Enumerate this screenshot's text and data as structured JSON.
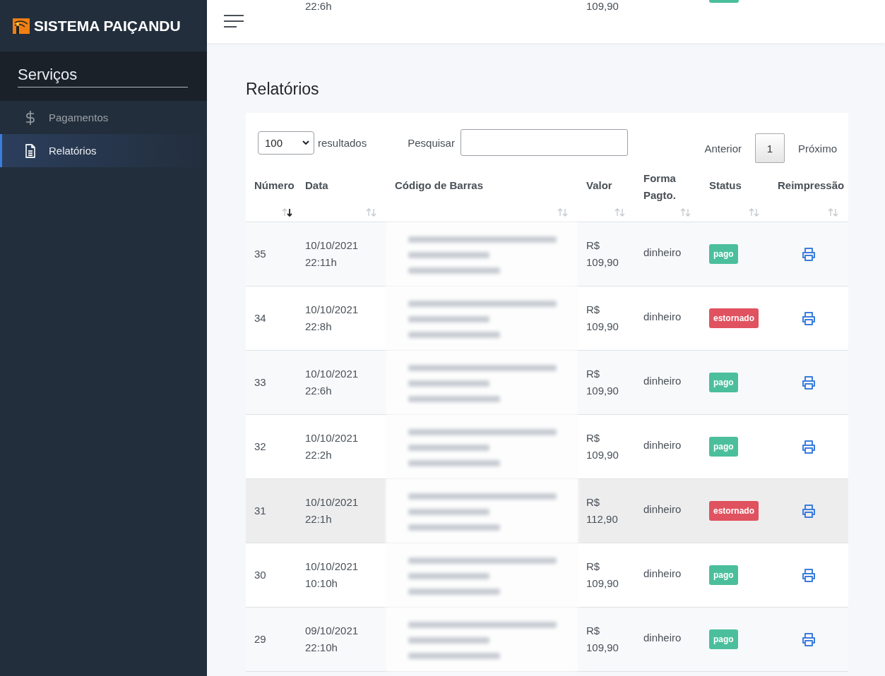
{
  "sidebar": {
    "brand": "SISTEMA PAIÇANDU",
    "section": "Serviços",
    "items": [
      {
        "label": "Pagamentos",
        "selected": false
      },
      {
        "label": "Relatórios",
        "selected": true
      }
    ]
  },
  "scrolled_row": {
    "date": "22:6h",
    "value": "109,90",
    "status": {
      "color": "#4bbf9b"
    }
  },
  "page_title": "Relatórios",
  "controls": {
    "page_size": "100",
    "page_size_label": "resultados",
    "search_label": "Pesquisar",
    "previous": "Anterior",
    "page": "1",
    "next": "Próximo"
  },
  "table": {
    "columns": [
      {
        "label": "Número",
        "sorted": true
      },
      {
        "label": "Data",
        "sorted": false
      },
      {
        "label": "Código de Barras",
        "sorted": false
      },
      {
        "label": "Valor",
        "sorted": false
      },
      {
        "label": "Forma Pagto.",
        "sorted": false
      },
      {
        "label": "Status",
        "sorted": false
      },
      {
        "label": "Reimpressão",
        "sorted": false
      }
    ],
    "rows": [
      {
        "number": "35",
        "date": "10/10/2021",
        "time": "22:11h",
        "currency": "R$",
        "value": "109,90",
        "method": "dinheiro",
        "status": {
          "label": "pago",
          "color": "#4bbf9b"
        },
        "hovered": false
      },
      {
        "number": "34",
        "date": "10/10/2021",
        "time": "22:8h",
        "currency": "R$",
        "value": "109,90",
        "method": "dinheiro",
        "status": {
          "label": "estornado",
          "color": "#e0525f"
        },
        "hovered": false
      },
      {
        "number": "33",
        "date": "10/10/2021",
        "time": "22:6h",
        "currency": "R$",
        "value": "109,90",
        "method": "dinheiro",
        "status": {
          "label": "pago",
          "color": "#4bbf9b"
        },
        "hovered": false
      },
      {
        "number": "32",
        "date": "10/10/2021",
        "time": "22:2h",
        "currency": "R$",
        "value": "109,90",
        "method": "dinheiro",
        "status": {
          "label": "pago",
          "color": "#4bbf9b"
        },
        "hovered": false
      },
      {
        "number": "31",
        "date": "10/10/2021",
        "time": "22:1h",
        "currency": "R$",
        "value": "112,90",
        "method": "dinheiro",
        "status": {
          "label": "estornado",
          "color": "#e0525f"
        },
        "hovered": true
      },
      {
        "number": "30",
        "date": "10/10/2021",
        "time": "10:10h",
        "currency": "R$",
        "value": "109,90",
        "method": "dinheiro",
        "status": {
          "label": "pago",
          "color": "#4bbf9b"
        },
        "hovered": false
      },
      {
        "number": "29",
        "date": "09/10/2021",
        "time": "22:10h",
        "currency": "R$",
        "value": "109,90",
        "method": "dinheiro",
        "status": {
          "label": "pago",
          "color": "#4bbf9b"
        },
        "hovered": false
      }
    ]
  }
}
